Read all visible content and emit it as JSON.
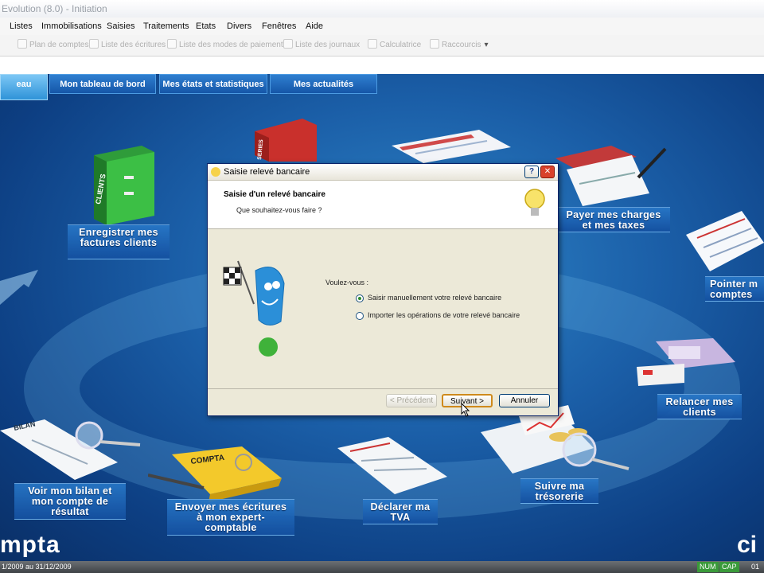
{
  "window": {
    "title": "Evolution (8.0) - Initiation"
  },
  "menu": [
    "Listes",
    "Immobilisations",
    "Saisies",
    "Traitements",
    "Etats",
    "Divers",
    "Fenêtres",
    "Aide"
  ],
  "toolbar": [
    "Plan de comptes",
    "Liste des écritures",
    "Liste des modes de paiement",
    "Liste des journaux",
    "Calculatrice",
    "Raccourcis"
  ],
  "tabs": {
    "active": "eau",
    "items": [
      "Mon tableau de bord",
      "Mes états et statistiques",
      "Mes actualités"
    ]
  },
  "actions": {
    "enregistrer": "Enregistrer mes factures clients",
    "payer": "Payer mes charges et mes taxes",
    "pointer": "Pointer m comptes",
    "relancer": "Relancer mes clients",
    "tresorerie": "Suivre ma trésorerie",
    "tva": "Déclarer ma TVA",
    "expert": "Envoyer mes écritures à mon expert-comptable",
    "bilan": "Voir mon bilan et mon compte de résultat"
  },
  "illustrations": {
    "clients_binder": "CLIENTS",
    "compta_box": "COMPTA",
    "bilan_doc": "BILAN",
    "red_binder": "SERIES"
  },
  "brand": {
    "left": "mpta",
    "right": "ci"
  },
  "dialog": {
    "title": "Saisie relevé bancaire",
    "heading": "Saisie d'un relevé bancaire",
    "subheading": "Que souhaitez-vous faire ?",
    "question": "Voulez-vous :",
    "options": [
      "Saisir manuellement votre relevé bancaire",
      "Importer les opérations de votre relevé bancaire"
    ],
    "selected_option": 0,
    "buttons": {
      "prev": "< Précédent",
      "next": "Suivant >",
      "cancel": "Annuler"
    },
    "help": "?",
    "close": "✕"
  },
  "status": {
    "period": "1/2009 au 31/12/2009",
    "badges": [
      "NUM",
      "CAP"
    ],
    "right": "01"
  },
  "colors": {
    "accent": "#1b5fa8",
    "dialog_bg": "#ece9d8",
    "close_red": "#d9412b"
  }
}
